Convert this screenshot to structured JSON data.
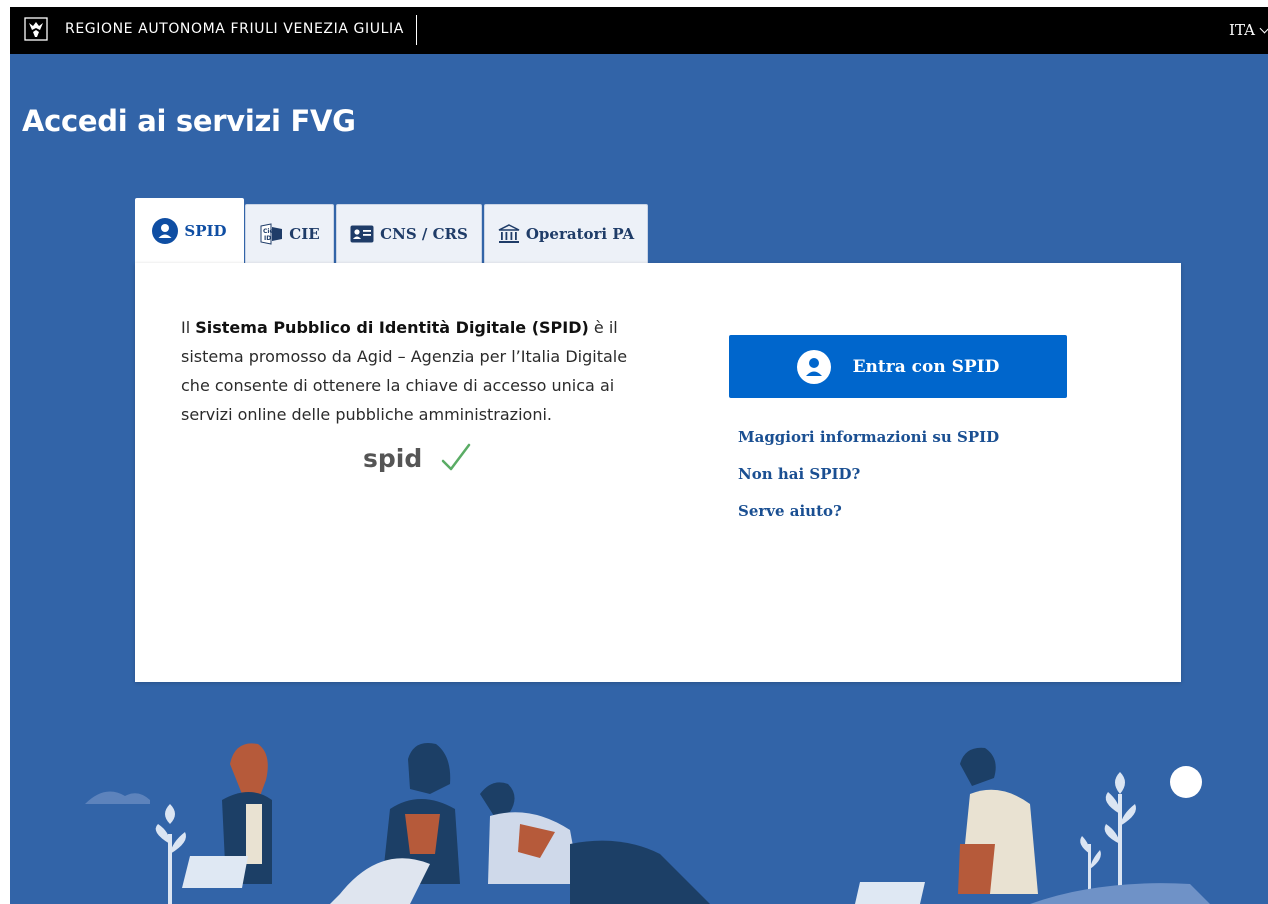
{
  "header": {
    "region_name": "REGIONE AUTONOMA FRIULI VENEZIA GIULIA",
    "language": "ITA",
    "logo_icon": "region-emblem-icon"
  },
  "page": {
    "title": "Accedi ai servizi FVG"
  },
  "tabs": [
    {
      "label": "SPID",
      "icon": "user-circle-icon",
      "active": true
    },
    {
      "label": "CIE",
      "icon": "cie-card-icon",
      "active": false
    },
    {
      "label": "CNS / CRS",
      "icon": "id-card-icon",
      "active": false
    },
    {
      "label": "Operatori PA",
      "icon": "institution-icon",
      "active": false
    }
  ],
  "spid_panel": {
    "description_prefix": "Il ",
    "description_bold": "Sistema Pubblico di Identità Digitale (SPID)",
    "description_suffix": " è il sistema promosso da Agid – Agenzia per l’Italia Digitale che consente di ottenere la chiave di accesso unica ai servizi online delle pubbliche amministrazioni.",
    "logo_text": "spid",
    "login_button": "Entra con SPID",
    "links": [
      "Maggiori informazioni su SPID",
      "Non hai SPID?",
      "Serve aiuto?"
    ]
  },
  "colors": {
    "header_bg": "#000000",
    "page_bg": "#3264a8",
    "primary_button": "#0066cc",
    "link": "#1a4f92",
    "spid_check": "#5aac65"
  }
}
